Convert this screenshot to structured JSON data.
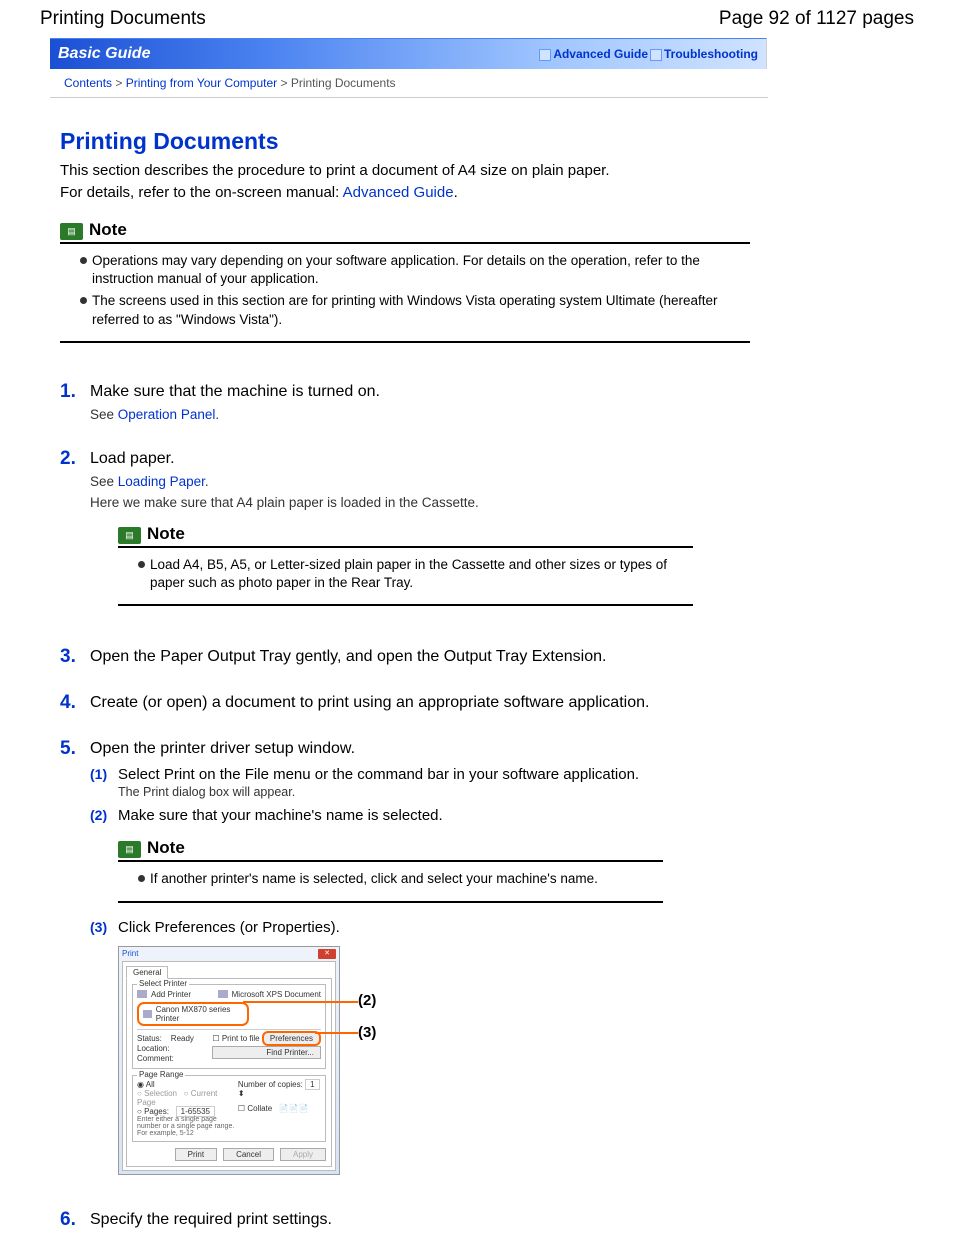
{
  "header": {
    "left": "Printing Documents",
    "right": "Page 92 of 1127 pages"
  },
  "bar": {
    "title": "Basic Guide",
    "link_advanced": "Advanced Guide",
    "link_trouble": "Troubleshooting"
  },
  "breadcrumb": {
    "contents": "Contents",
    "printing_from": "Printing from Your Computer",
    "sep": " > ",
    "current": "Printing Documents"
  },
  "page_title": "Printing Documents",
  "intro_line1": "This section describes the procedure to print a document of A4 size on plain paper.",
  "intro_line2_prefix": "For details, refer to the on-screen manual: ",
  "intro_line2_link": "Advanced Guide",
  "intro_line2_suffix": ".",
  "note_label": "Note",
  "top_note": {
    "b1": "Operations may vary depending on your software application. For details on the operation, refer to the instruction manual of your application.",
    "b2": "The screens used in this section are for printing with Windows Vista operating system Ultimate (hereafter referred to as \"Windows Vista\")."
  },
  "see_label": "See ",
  "steps": {
    "s1": {
      "text": "Make sure that the machine is turned on.",
      "link": "Operation Panel",
      "after": "."
    },
    "s2": {
      "text": "Load paper.",
      "link": "Loading Paper",
      "after": ".",
      "extra": "Here we make sure that A4 plain paper is loaded in the Cassette.",
      "note_bullet": "Load A4, B5, A5, or Letter-sized plain paper in the Cassette and other sizes or types of paper such as photo paper in the Rear Tray."
    },
    "s3": {
      "text": "Open the Paper Output Tray gently, and open the Output Tray Extension."
    },
    "s4": {
      "text": "Create (or open) a document to print using an appropriate software application."
    },
    "s5": {
      "text": "Open the printer driver setup window.",
      "sub1": "Select Print on the File menu or the command bar in your software application.",
      "sub1_note": "The Print dialog box will appear.",
      "sub2": "Make sure that your machine's name is selected.",
      "sub2_note_bullet": "If another printer's name is selected, click and select your machine's name.",
      "sub3": "Click Preferences (or Properties)."
    },
    "s6": {
      "text": "Specify the required print settings."
    }
  },
  "dialog": {
    "title": "Print",
    "tab": "General",
    "section_select_printer": "Select Printer",
    "add_printer": "Add Printer",
    "ms_xps": "Microsoft XPS Document",
    "canon_printer": "Canon MX870 series Printer",
    "status_label": "Status:",
    "status_value": "Ready",
    "location_label": "Location:",
    "comment_label": "Comment:",
    "print_to_file": "Print to file",
    "preferences": "Preferences",
    "find_printer": "Find Printer...",
    "page_range": "Page Range",
    "all": "All",
    "selection": "Selection",
    "current_page": "Current Page",
    "pages": "Pages:",
    "pages_value": "1-65535",
    "pages_hint": "Enter either a single page number or a single page range. For example, 5-12",
    "copies_label": "Number of copies:",
    "copies_value": "1",
    "collate": "Collate",
    "btn_print": "Print",
    "btn_cancel": "Cancel",
    "btn_apply": "Apply",
    "callout2": "(2)",
    "callout3": "(3)"
  }
}
